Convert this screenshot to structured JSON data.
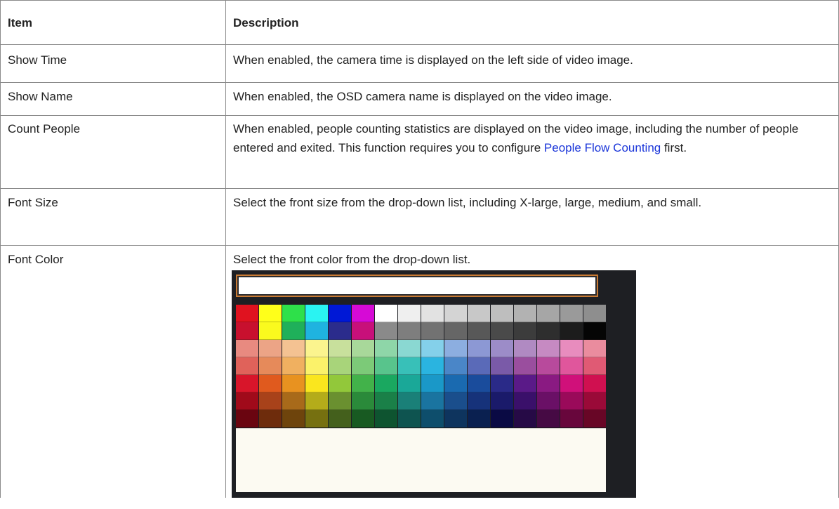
{
  "table": {
    "headers": [
      "Item",
      "Description"
    ],
    "rows": [
      {
        "item": "Show Time",
        "desc": "When enabled, the camera time is displayed on the left side of video image."
      },
      {
        "item": "Show Name",
        "desc": "When enabled, the OSD camera name is displayed on the video image."
      },
      {
        "item": "Count People",
        "desc_before": "When enabled, people counting statistics are displayed on the video image, including the number of people entered and exited. This function requires you to configure ",
        "link": "People Flow Counting",
        "desc_after": " first."
      },
      {
        "item": "Font Size",
        "desc": "Select the front size from the drop-down list, including X-large, large, medium, and small."
      },
      {
        "item": "Font Color",
        "desc": "Select the front color from the drop-down list."
      }
    ]
  },
  "colors": {
    "link": "#1a35d9",
    "border": "#8a8a8a",
    "palette_frame": "#1e1f23",
    "palette_input_border": "#c87a33"
  },
  "palette": [
    [
      "#e0121f",
      "#ffff1a",
      "#2ee04a",
      "#2af3f2",
      "#0018d6",
      "#d60ad6",
      "#ffffff",
      "#efefef",
      "#e2e2e2",
      "#d4d4d4",
      "#c8c8c8",
      "#bebebe",
      "#b2b2b2",
      "#a6a6a6",
      "#9a9a9a",
      "#8e8e8e"
    ],
    [
      "#c8102e",
      "#fafa1e",
      "#1fb05a",
      "#1fb3e0",
      "#2b2c8c",
      "#c8107a",
      "#8a8a8a",
      "#7e7e7e",
      "#727272",
      "#666666",
      "#585858",
      "#4a4a4a",
      "#3c3c3c",
      "#2e2e2e",
      "#1c1c1c",
      "#050505"
    ],
    [
      "#e88a80",
      "#eca486",
      "#f4c292",
      "#fbf48e",
      "#c8e09c",
      "#a8d89a",
      "#8ed6a8",
      "#8ad8d2",
      "#84d0ea",
      "#8caee0",
      "#8c98d4",
      "#9c8cc8",
      "#b08ac2",
      "#c68ac2",
      "#e88cbe",
      "#ea8c9e"
    ],
    [
      "#e0625a",
      "#e68a5a",
      "#f0b060",
      "#fbf26a",
      "#a8d47a",
      "#7cca78",
      "#58c48c",
      "#38c0b8",
      "#2ab4e0",
      "#4a86c8",
      "#5a6ab8",
      "#7a5aa8",
      "#9a4e9e",
      "#b84a9c",
      "#e0569c",
      "#e05a74"
    ],
    [
      "#d8152a",
      "#e05a1e",
      "#e89220",
      "#fae61e",
      "#92c83a",
      "#42b24a",
      "#1aa860",
      "#1aa898",
      "#1a98c8",
      "#1a6ab0",
      "#1a4c9c",
      "#2a2a88",
      "#5a1a88",
      "#8a1a82",
      "#d0107a",
      "#d01050"
    ],
    [
      "#a00a1a",
      "#a8421a",
      "#a86a1a",
      "#b4ac1a",
      "#6a9030",
      "#2a8a3a",
      "#1a8048",
      "#1a8078",
      "#1a74a0",
      "#1a4e8c",
      "#16327a",
      "#1a1a6a",
      "#3a106a",
      "#6a1066",
      "#9a0a5a",
      "#9a0a38"
    ],
    [
      "#6a0510",
      "#6e2c0c",
      "#6e440c",
      "#767010",
      "#44601c",
      "#185a22",
      "#0e5430",
      "#0e5450",
      "#0e4e6c",
      "#0e345e",
      "#0a2050",
      "#0a0a44",
      "#260a46",
      "#460a44",
      "#68063c",
      "#680626"
    ]
  ]
}
